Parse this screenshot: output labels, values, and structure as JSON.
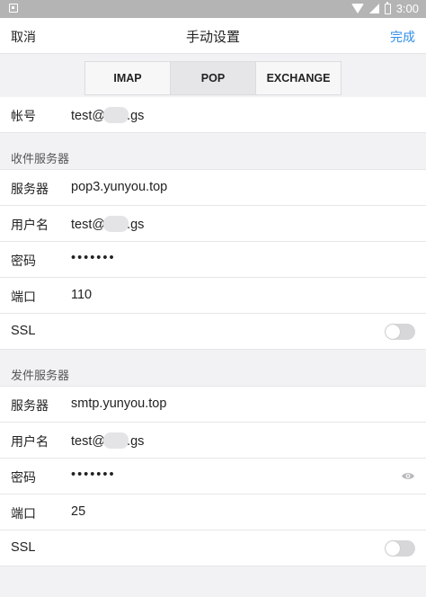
{
  "status_bar": {
    "time": "3:00"
  },
  "nav": {
    "cancel": "取消",
    "title": "手动设置",
    "done": "完成"
  },
  "tabs": [
    {
      "label": "IMAP"
    },
    {
      "label": "POP"
    },
    {
      "label": "EXCHANGE"
    }
  ],
  "account": {
    "label": "帐号",
    "value_prefix": "test@",
    "value_suffix": ".gs"
  },
  "incoming": {
    "header": "收件服务器",
    "server_label": "服务器",
    "server_value": "pop3.yunyou.top",
    "username_label": "用户名",
    "username_prefix": "test@",
    "username_suffix": ".gs",
    "password_label": "密码",
    "password_value": "•••••••",
    "port_label": "端口",
    "port_value": "110",
    "ssl_label": "SSL"
  },
  "outgoing": {
    "header": "发件服务器",
    "server_label": "服务器",
    "server_value": "smtp.yunyou.top",
    "username_label": "用户名",
    "username_prefix": "test@",
    "username_suffix": ".gs",
    "password_label": "密码",
    "password_value": "•••••••",
    "port_label": "端口",
    "port_value": "25",
    "ssl_label": "SSL"
  }
}
